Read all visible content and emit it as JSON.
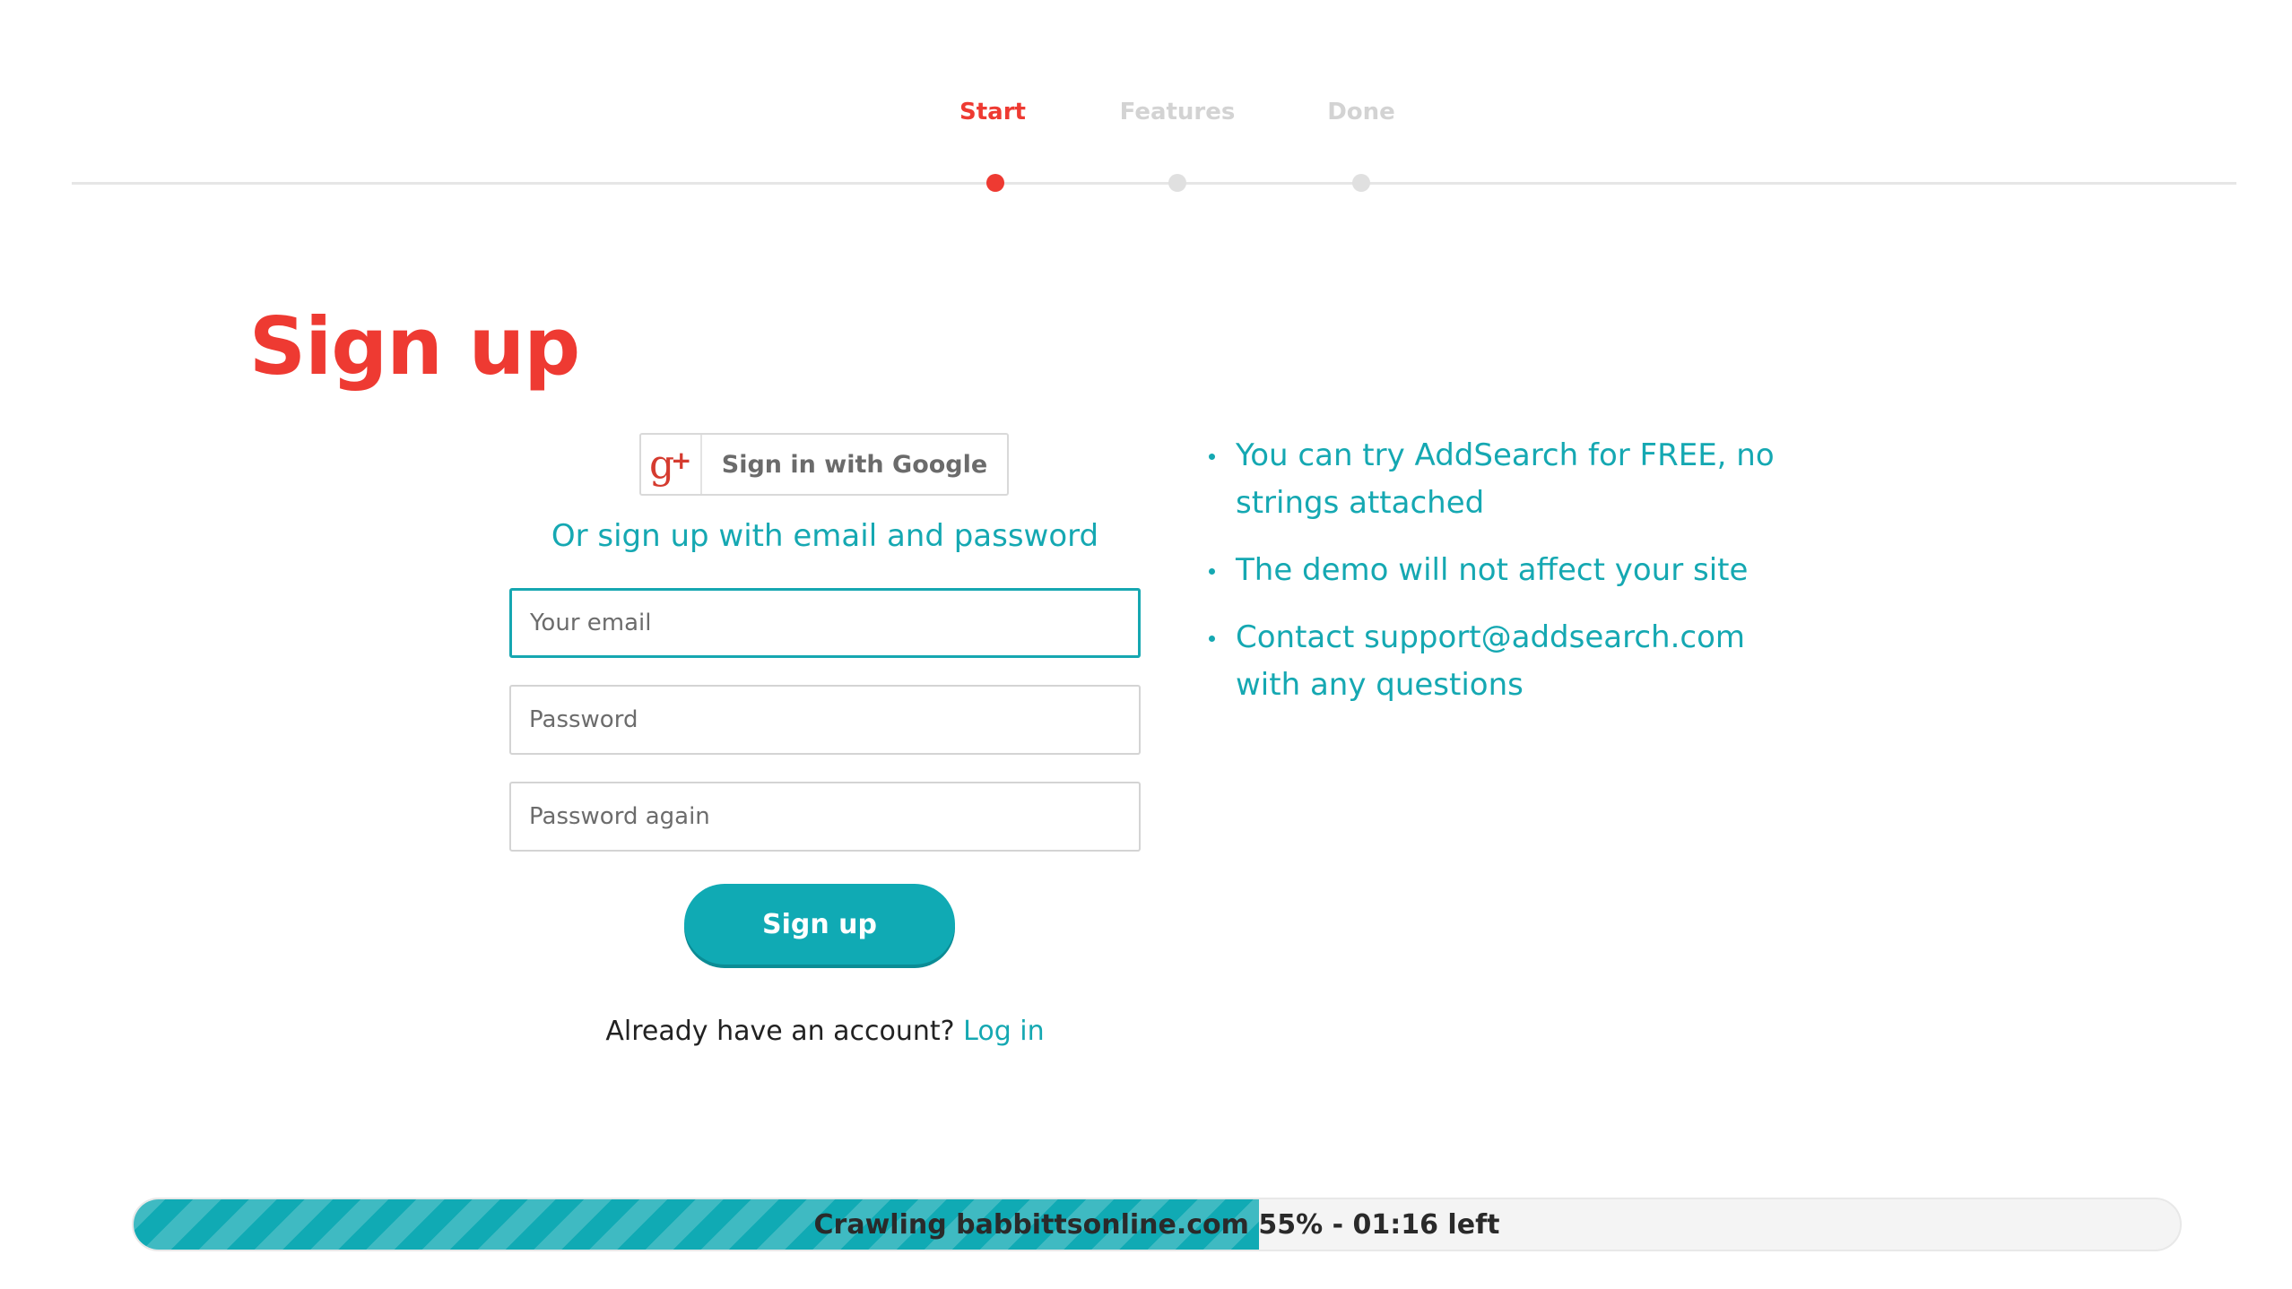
{
  "steps": {
    "items": [
      {
        "label": "Start"
      },
      {
        "label": "Features"
      },
      {
        "label": "Done"
      }
    ],
    "active_index": 0
  },
  "form": {
    "title": "Sign up",
    "google_button": "Sign in with Google",
    "google_icon": "google-plus-icon",
    "or_text": "Or sign up with email and password",
    "email": {
      "placeholder": "Your email",
      "value": ""
    },
    "password": {
      "placeholder": "Password",
      "value": ""
    },
    "password_again": {
      "placeholder": "Password again",
      "value": ""
    },
    "submit_label": "Sign up",
    "login_prompt": "Already have an account?",
    "login_link": "Log in"
  },
  "info": {
    "bullets": [
      "You can try AddSearch for FREE, no strings attached",
      "The demo will not affect your site",
      "Contact support@addsearch.com with any questions"
    ]
  },
  "crawl": {
    "domain": "babbittsonline.com",
    "percent_label": "55%",
    "time_left": "01:16",
    "status_text": "Crawling babbittsonline.com 55% - 01:16 left",
    "progress_fraction": 0.55
  },
  "colors": {
    "accent_red": "#ee3a32",
    "accent_teal": "#15a8b2",
    "button_teal": "#10aab4"
  }
}
